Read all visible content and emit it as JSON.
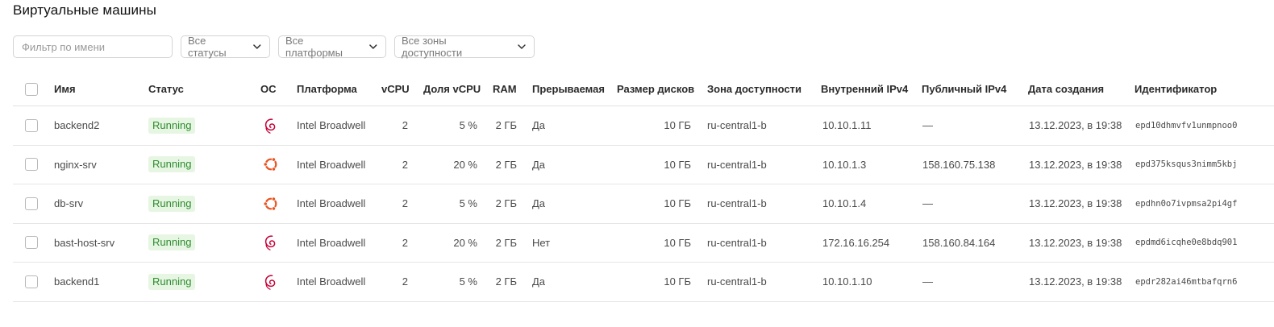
{
  "page": {
    "title": "Виртуальные машины"
  },
  "filters": {
    "name_placeholder": "Фильтр по имени",
    "status_label": "Все статусы",
    "platform_label": "Все платформы",
    "zone_label": "Все зоны доступности"
  },
  "table": {
    "headers": {
      "name": "Имя",
      "status": "Статус",
      "os": "ОС",
      "platform": "Платформа",
      "vcpu": "vCPU",
      "vcpu_share": "Доля vCPU",
      "ram": "RAM",
      "preemptible": "Прерываемая",
      "disk_size": "Размер дисков",
      "zone": "Зона доступности",
      "internal_ip": "Внутренний IPv4",
      "public_ip": "Публичный IPv4",
      "created": "Дата создания",
      "id": "Идентификатор"
    },
    "rows": [
      {
        "name": "backend2",
        "status": "Running",
        "os": "debian-icon",
        "platform": "Intel Broadwell",
        "vcpu": "2",
        "vcpu_share": "5 %",
        "ram": "2 ГБ",
        "preemptible": "Да",
        "disk_size": "10 ГБ",
        "zone": "ru-central1-b",
        "internal_ip": "10.10.1.11",
        "public_ip": "—",
        "created": "13.12.2023, в 19:38",
        "id": "epd10dhmvfv1unmpnoo0"
      },
      {
        "name": "nginx-srv",
        "status": "Running",
        "os": "ubuntu-icon",
        "platform": "Intel Broadwell",
        "vcpu": "2",
        "vcpu_share": "20 %",
        "ram": "2 ГБ",
        "preemptible": "Да",
        "disk_size": "10 ГБ",
        "zone": "ru-central1-b",
        "internal_ip": "10.10.1.3",
        "public_ip": "158.160.75.138",
        "created": "13.12.2023, в 19:38",
        "id": "epd375ksqus3nimm5kbj"
      },
      {
        "name": "db-srv",
        "status": "Running",
        "os": "ubuntu-icon",
        "platform": "Intel Broadwell",
        "vcpu": "2",
        "vcpu_share": "5 %",
        "ram": "2 ГБ",
        "preemptible": "Да",
        "disk_size": "10 ГБ",
        "zone": "ru-central1-b",
        "internal_ip": "10.10.1.4",
        "public_ip": "—",
        "created": "13.12.2023, в 19:38",
        "id": "epdhn0o7ivpmsa2pi4gf"
      },
      {
        "name": "bast-host-srv",
        "status": "Running",
        "os": "debian-icon",
        "platform": "Intel Broadwell",
        "vcpu": "2",
        "vcpu_share": "20 %",
        "ram": "2 ГБ",
        "preemptible": "Нет",
        "disk_size": "10 ГБ",
        "zone": "ru-central1-b",
        "internal_ip": "172.16.16.254",
        "public_ip": "158.160.84.164",
        "created": "13.12.2023, в 19:38",
        "id": "epdmd6icqhe0e8bdq901"
      },
      {
        "name": "backend1",
        "status": "Running",
        "os": "debian-icon",
        "platform": "Intel Broadwell",
        "vcpu": "2",
        "vcpu_share": "5 %",
        "ram": "2 ГБ",
        "preemptible": "Да",
        "disk_size": "10 ГБ",
        "zone": "ru-central1-b",
        "internal_ip": "10.10.1.10",
        "public_ip": "—",
        "created": "13.12.2023, в 19:38",
        "id": "epdr282ai46mtbafqrn6"
      }
    ]
  },
  "colors": {
    "running_bg": "#e6f6e3",
    "running_text": "#2e8b2e",
    "debian": "#c70036",
    "ubuntu": "#e95420"
  }
}
